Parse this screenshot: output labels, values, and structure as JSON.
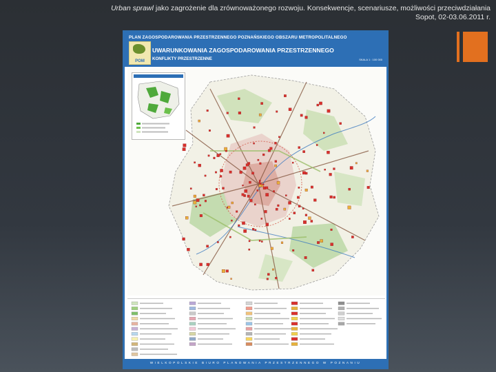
{
  "slide": {
    "title_italic": "Urban sprawl",
    "title_rest": " jako zagrożenie dla zrównoważonego rozwoju. Konsekwencje, scenariusze, możliwości przeciwdziałania",
    "subtitle": "Sopot, 02-03.06.2011 r."
  },
  "map": {
    "plan_title": "PLAN ZAGOSPODAROWANIA PRZESTRZENNEGO POZNAŃSKIEGO OBSZARU METROPOLITALNEGO",
    "logo_text": "POM",
    "main_title": "UWARUNKOWANIA ZAGOSPODAROWANIA PRZESTRZENNEGO",
    "sub_title": "KONFLIKTY PRZESTRZENNE",
    "scale": "SKALA 1 : 100 000",
    "footer": "WIELKOPOLSKIE BIURO PLANOWANIA PRZESTRZENNEGO W POZNANIU",
    "colors": {
      "frame": "#2e6fb2",
      "urban": "#e9c6c0",
      "forest": "#b9d7a2",
      "conflict": "#d8312d",
      "roads": "#7f4f37"
    }
  }
}
